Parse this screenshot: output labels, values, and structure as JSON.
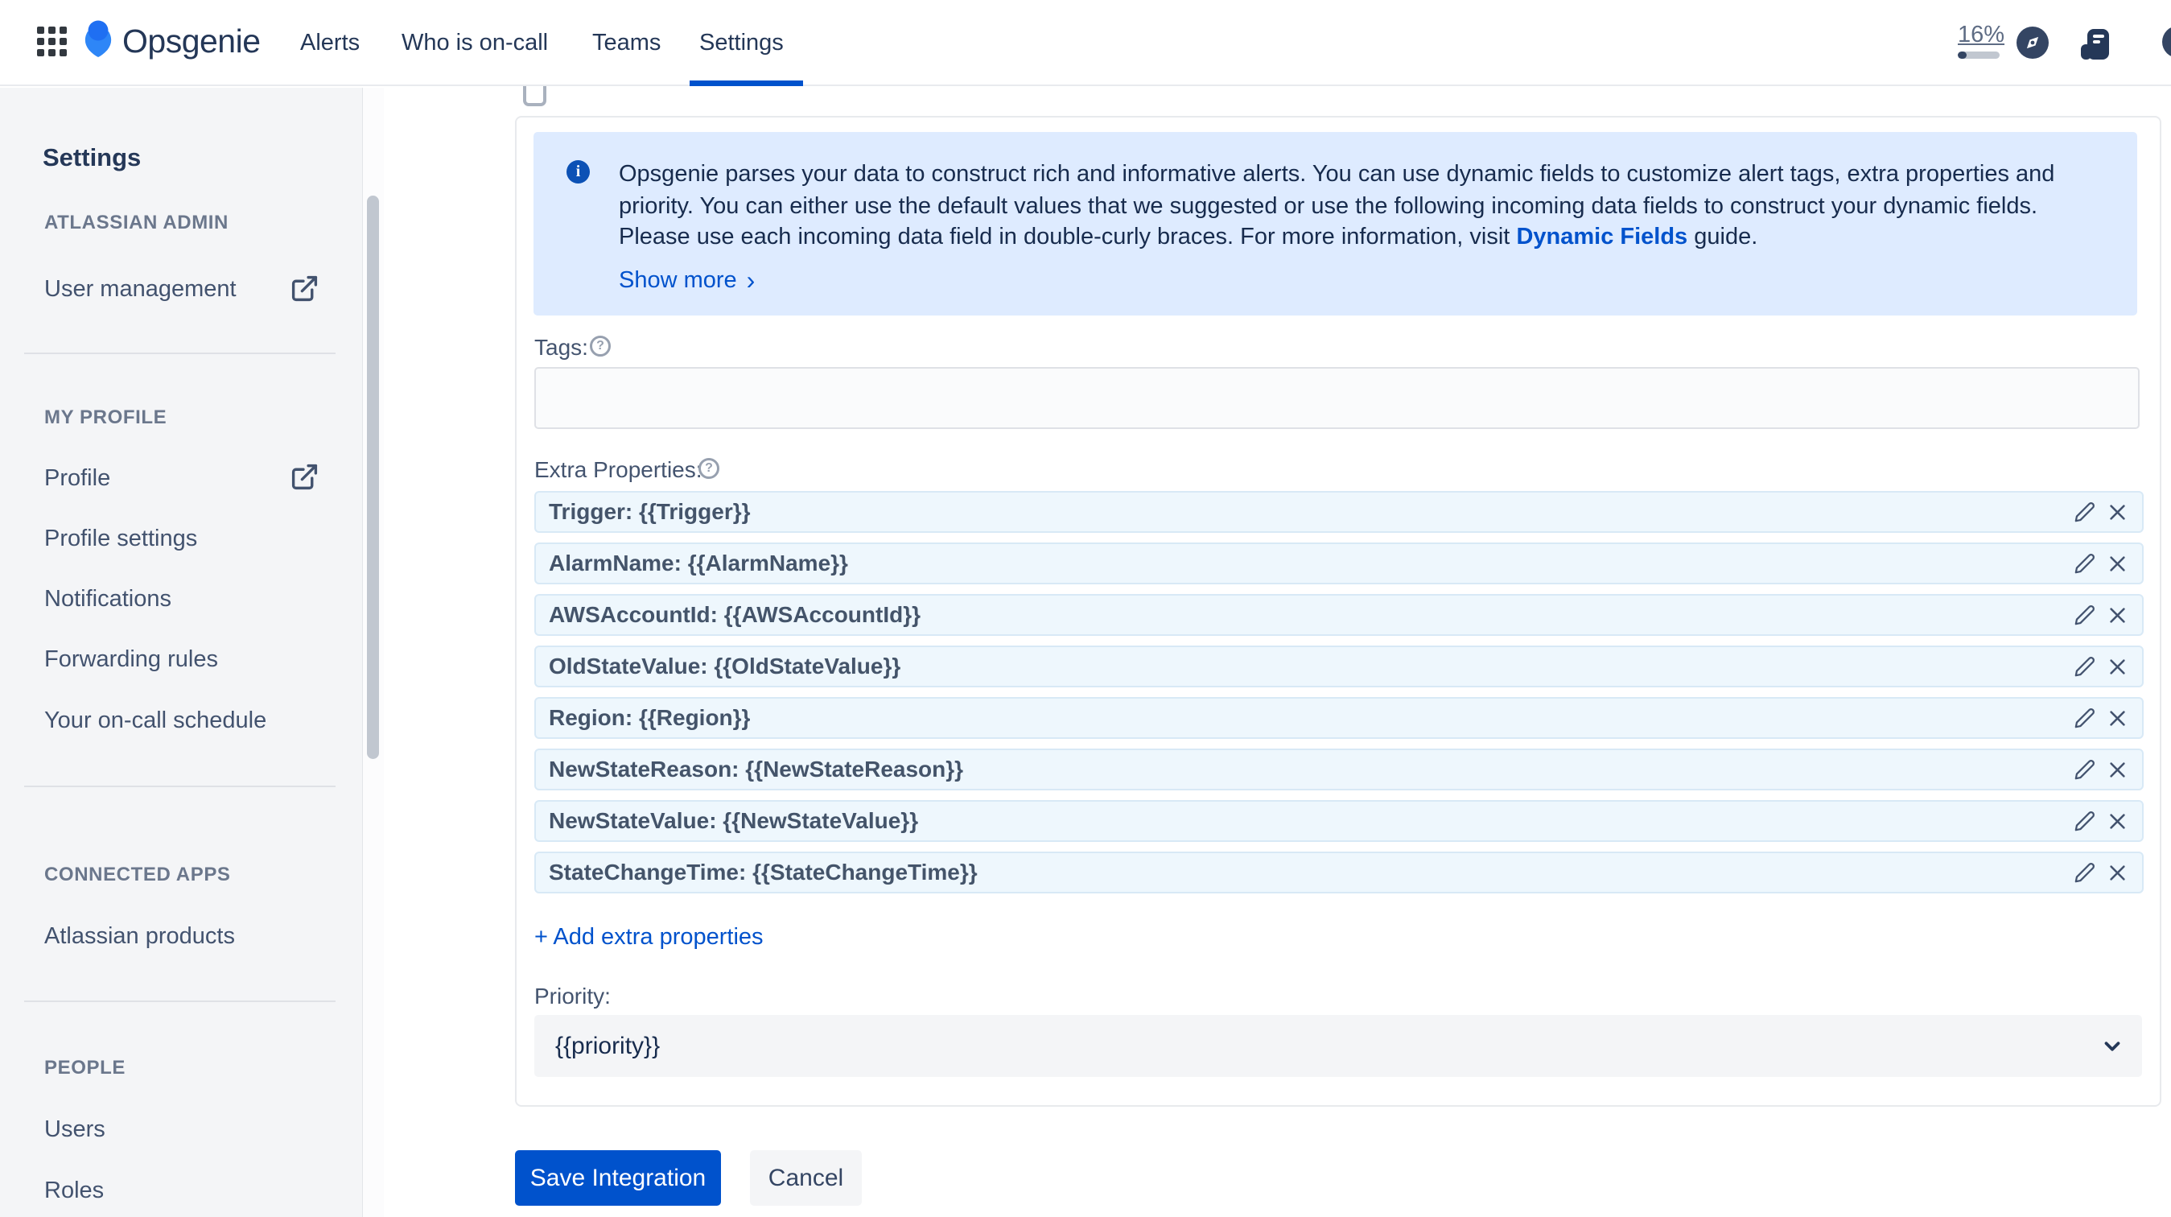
{
  "header": {
    "app_name": "Opsgenie",
    "nav": [
      {
        "label": "Alerts",
        "active": false
      },
      {
        "label": "Who is on-call",
        "active": false
      },
      {
        "label": "Teams",
        "active": false
      },
      {
        "label": "Settings",
        "active": true
      }
    ],
    "usage_percent": "16%",
    "icons": [
      "app-switcher-grid-icon",
      "opsgenie-logo-icon",
      "compass-icon",
      "release-notes-icon",
      "help-icon"
    ]
  },
  "sidebar": {
    "title": "Settings",
    "sections": [
      {
        "label": "ATLASSIAN ADMIN",
        "items": [
          {
            "label": "User management",
            "external": true
          }
        ]
      },
      {
        "label": "MY PROFILE",
        "items": [
          {
            "label": "Profile",
            "external": true
          },
          {
            "label": "Profile settings",
            "external": false
          },
          {
            "label": "Notifications",
            "external": false
          },
          {
            "label": "Forwarding rules",
            "external": false
          },
          {
            "label": "Your on-call schedule",
            "external": false
          }
        ]
      },
      {
        "label": "CONNECTED APPS",
        "items": [
          {
            "label": "Atlassian products",
            "external": false
          }
        ]
      },
      {
        "label": "PEOPLE",
        "items": [
          {
            "label": "Users",
            "external": false
          },
          {
            "label": "Roles",
            "external": false
          }
        ]
      }
    ]
  },
  "main": {
    "info_banner": {
      "line1": "Opsgenie parses your data to construct rich and informative alerts. You can use dynamic fields to customize alert tags, extra properties and",
      "line2": "priority. You can either use the default values that we suggested or use the following incoming data fields to construct your dynamic fields.",
      "line3_pre": "Please use each incoming data field in double-curly braces. For more information, visit ",
      "line3_link": "Dynamic Fields",
      "line3_post": " guide.",
      "show_more": "Show more",
      "show_more_chevron": "›"
    },
    "tags": {
      "label": "Tags:",
      "value": "",
      "help_glyph": "?"
    },
    "extra_properties": {
      "label": "Extra Properties:",
      "help_glyph": "?",
      "rows": [
        "Trigger: {{Trigger}}",
        "AlarmName: {{AlarmName}}",
        "AWSAccountId: {{AWSAccountId}}",
        "OldStateValue: {{OldStateValue}}",
        "Region: {{Region}}",
        "NewStateReason: {{NewStateReason}}",
        "NewStateValue: {{NewStateValue}}",
        "StateChangeTime: {{StateChangeTime}}"
      ],
      "add_link": "+ Add extra properties"
    },
    "priority": {
      "label": "Priority:",
      "value": "{{priority}}"
    },
    "buttons": {
      "save": "Save Integration",
      "cancel": "Cancel"
    },
    "help_glyph": "?"
  },
  "colors": {
    "accent": "#0052cc",
    "navy": "#253858",
    "banner_bg": "#deebff",
    "info_icon": "#0c51b5",
    "row_bg": "#eef7fd",
    "row_border": "#d8e9f6",
    "sidebar_bg": "#f4f5f7",
    "muted": "#5e6c84"
  }
}
